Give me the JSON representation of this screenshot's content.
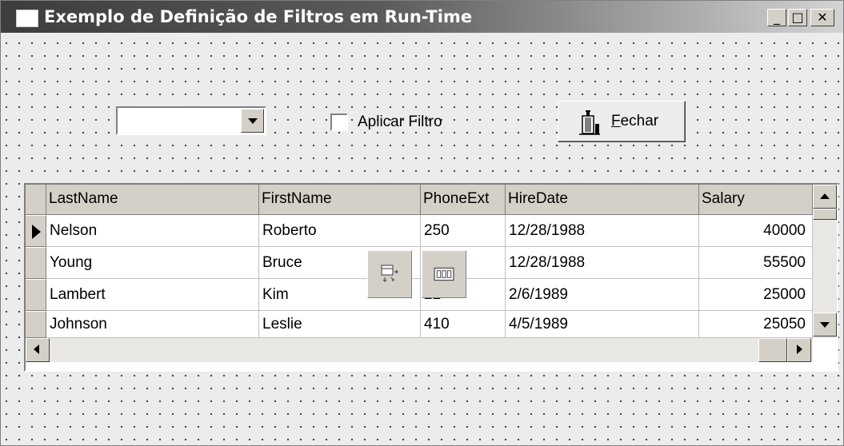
{
  "window": {
    "title": "Exemplo de Definição de Filtros em Run-Time",
    "controls": {
      "minimize": "_",
      "maximize": "□",
      "close": "✕"
    }
  },
  "form": {
    "combo": {
      "value": ""
    },
    "checkbox": {
      "label": "Aplicar Filtro",
      "checked": false
    },
    "close_button": {
      "label_rest": "echar",
      "label_accel": "F",
      "icon": "door-exit-icon"
    }
  },
  "grid": {
    "columns": [
      "LastName",
      "FirstName",
      "PhoneExt",
      "HireDate",
      "Salary"
    ],
    "rows": [
      {
        "LastName": "Nelson",
        "FirstName": "Roberto",
        "PhoneExt": "250",
        "HireDate": "12/28/1988",
        "Salary": "40000",
        "current": true
      },
      {
        "LastName": "Young",
        "FirstName": "Bruce",
        "PhoneExt": "",
        "HireDate": "12/28/1988",
        "Salary": "55500",
        "current": false
      },
      {
        "LastName": "Lambert",
        "FirstName": "Kim",
        "PhoneExt": "22",
        "HireDate": "2/6/1989",
        "Salary": "25000",
        "current": false
      },
      {
        "LastName": "Johnson",
        "FirstName": "Leslie",
        "PhoneExt": "410",
        "HireDate": "4/5/1989",
        "Salary": "25050",
        "current": false
      }
    ]
  },
  "nonvisual_components": [
    {
      "icon": "table-component-icon"
    },
    {
      "icon": "datasource-component-icon"
    }
  ]
}
